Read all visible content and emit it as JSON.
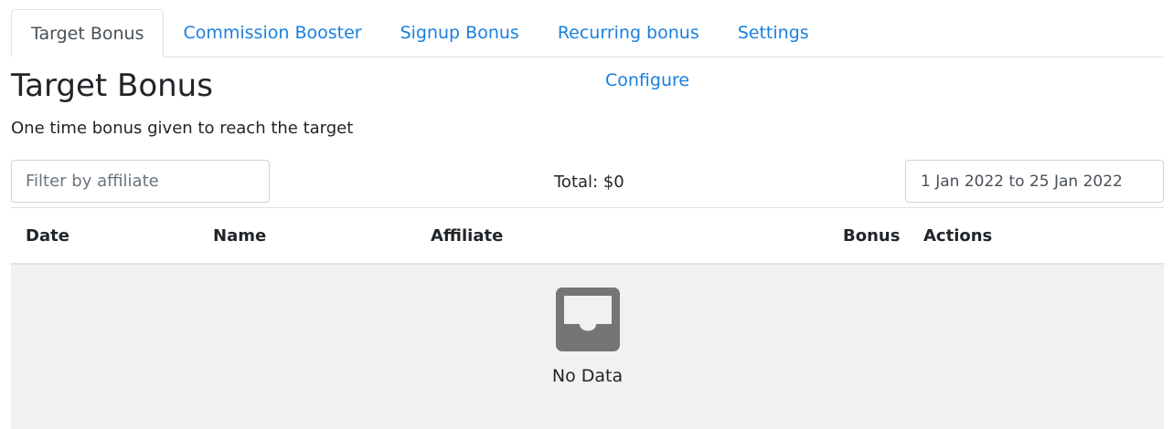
{
  "tabs": [
    {
      "label": "Target Bonus",
      "active": true
    },
    {
      "label": "Commission Booster",
      "active": false
    },
    {
      "label": "Signup Bonus",
      "active": false
    },
    {
      "label": "Recurring bonus",
      "active": false
    },
    {
      "label": "Settings",
      "active": false
    }
  ],
  "header": {
    "title": "Target Bonus",
    "configure_label": "Configure",
    "subtitle": "One time bonus given to reach the target"
  },
  "toolbar": {
    "filter_placeholder": "Filter by affiliate",
    "filter_value": "",
    "total_text": "Total: $0",
    "date_range": "1 Jan 2022 to 25 Jan 2022"
  },
  "table": {
    "columns": [
      "Date",
      "Name",
      "Affiliate",
      "Bonus",
      "Actions"
    ],
    "rows": [],
    "empty_text": "No Data",
    "empty_icon": "empty-inbox-icon"
  },
  "colors": {
    "link": "#1a7fe0",
    "empty_bg": "#f1f1f1",
    "empty_icon": "#757575"
  }
}
